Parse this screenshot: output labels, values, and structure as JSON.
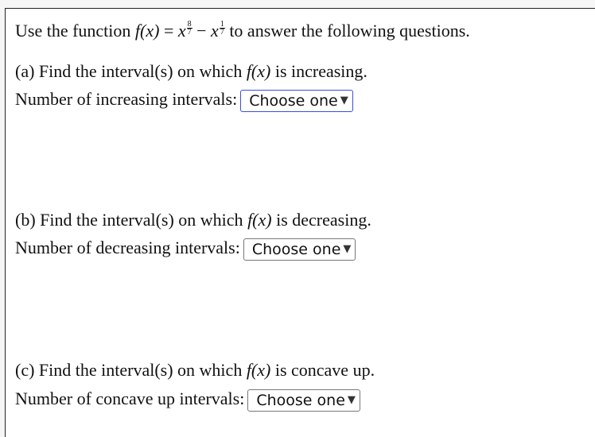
{
  "intro": {
    "prefix": "Use the function ",
    "func_name": "f(x)",
    "equals": " = ",
    "base1": "x",
    "exp1_num": "8",
    "exp1_den": "7",
    "minus": " − ",
    "base2": "x",
    "exp2_num": "1",
    "exp2_den": "7",
    "suffix": " to answer the following questions."
  },
  "parts": [
    {
      "question_prefix": "(a) Find the interval(s) on which ",
      "func": "f(x)",
      "question_suffix": " is increasing.",
      "count_label": "Number of increasing intervals:",
      "select_value": "Choose one",
      "focused": true
    },
    {
      "question_prefix": "(b) Find the interval(s) on which ",
      "func": "f(x)",
      "question_suffix": " is decreasing.",
      "count_label": "Number of decreasing intervals:",
      "select_value": "Choose one",
      "focused": false
    },
    {
      "question_prefix": "(c) Find the interval(s) on which ",
      "func": "f(x)",
      "question_suffix": " is concave up.",
      "count_label": "Number of concave up intervals:",
      "select_value": "Choose one",
      "focused": false
    }
  ],
  "icons": {
    "dropdown_arrow": "▼"
  },
  "colors": {
    "focus_border": "#3a4fd8"
  }
}
